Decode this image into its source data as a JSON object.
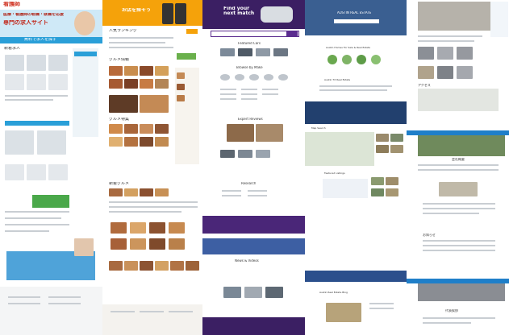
{
  "columns": [
    {
      "id": "jp-job-portal",
      "title": "看護師求人サイト",
      "hero": "医療・看護師の転職・就職を応援",
      "sub": "専門の求人サイト",
      "accent": "#2a9fd8",
      "banner_cta": "無料で求人を探す",
      "section": "新着求人",
      "footer_logo": "看護師"
    },
    {
      "id": "jp-food",
      "title": "人気のレストラン",
      "hero": "お店を探そう",
      "section_ranking": "人気ランキング",
      "section_gourmet": "グルメ特集",
      "section_new": "新着グルメ",
      "section_food": "グルメ情報",
      "cta": "予約する",
      "accent": "#f5a20a"
    },
    {
      "id": "cars",
      "title": "Find your next match",
      "search_btn": "Search",
      "section_featured": "Featured Cars",
      "section_browse": "Browse by Make",
      "section_research": "Research",
      "section_reviews": "Expert Reviews",
      "section_news": "News & Videos",
      "accent": "#5b2c8f"
    },
    {
      "id": "realestate",
      "title": "AUSTIN REAL ESTATE",
      "subtitle": "Find Homes For Sale",
      "section_neighborhoods": "Austin Homes For Sale & Real Estate",
      "section_listings": "Austin TX Real Estate",
      "section_map": "Map Search",
      "section_featured": "Featured Listings",
      "section_blog": "Austin Real Estate Blog",
      "accent": "#2b4f8c"
    },
    {
      "id": "jp-corporate",
      "title": "企業情報",
      "section_news": "お知らせ",
      "section_about": "会社概要",
      "section_access": "アクセス",
      "section_message": "代表挨拶",
      "accent": "#1f7fc9"
    }
  ],
  "icons": [
    "job-logo",
    "magnifier-icon",
    "car-icon",
    "house-icon",
    "building-icon"
  ]
}
